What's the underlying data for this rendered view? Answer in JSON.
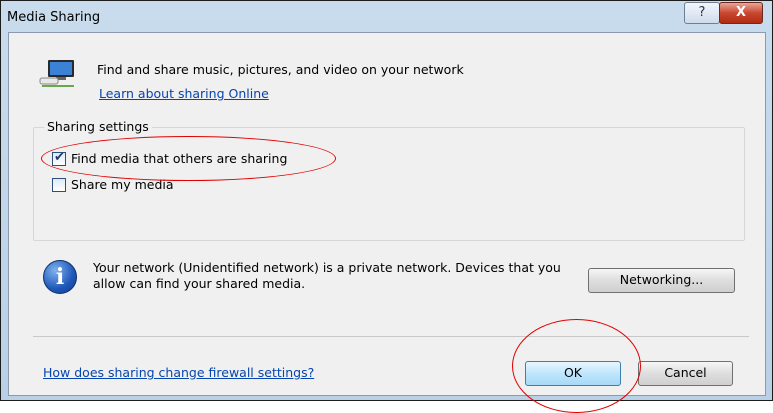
{
  "window": {
    "title": "Media Sharing",
    "help_button": "?",
    "close_button": "X"
  },
  "header": {
    "icon": "media-network-icon",
    "text": "Find and share music, pictures, and video on your network",
    "learn_link": "Learn about sharing Online"
  },
  "sharing_settings": {
    "label": "Sharing settings",
    "find_media": {
      "label": "Find media that others are sharing",
      "checked": true
    },
    "share_media": {
      "label": "Share my media",
      "checked": false
    }
  },
  "network": {
    "icon": "info-icon",
    "text": "Your network (Unidentified network) is a private network. Devices that you allow can find your shared media.",
    "networking_button": "Networking..."
  },
  "footer": {
    "firewall_link": "How does sharing change firewall settings?",
    "ok_button": "OK",
    "cancel_button": "Cancel"
  },
  "annotation": {
    "color": "#e00000"
  }
}
